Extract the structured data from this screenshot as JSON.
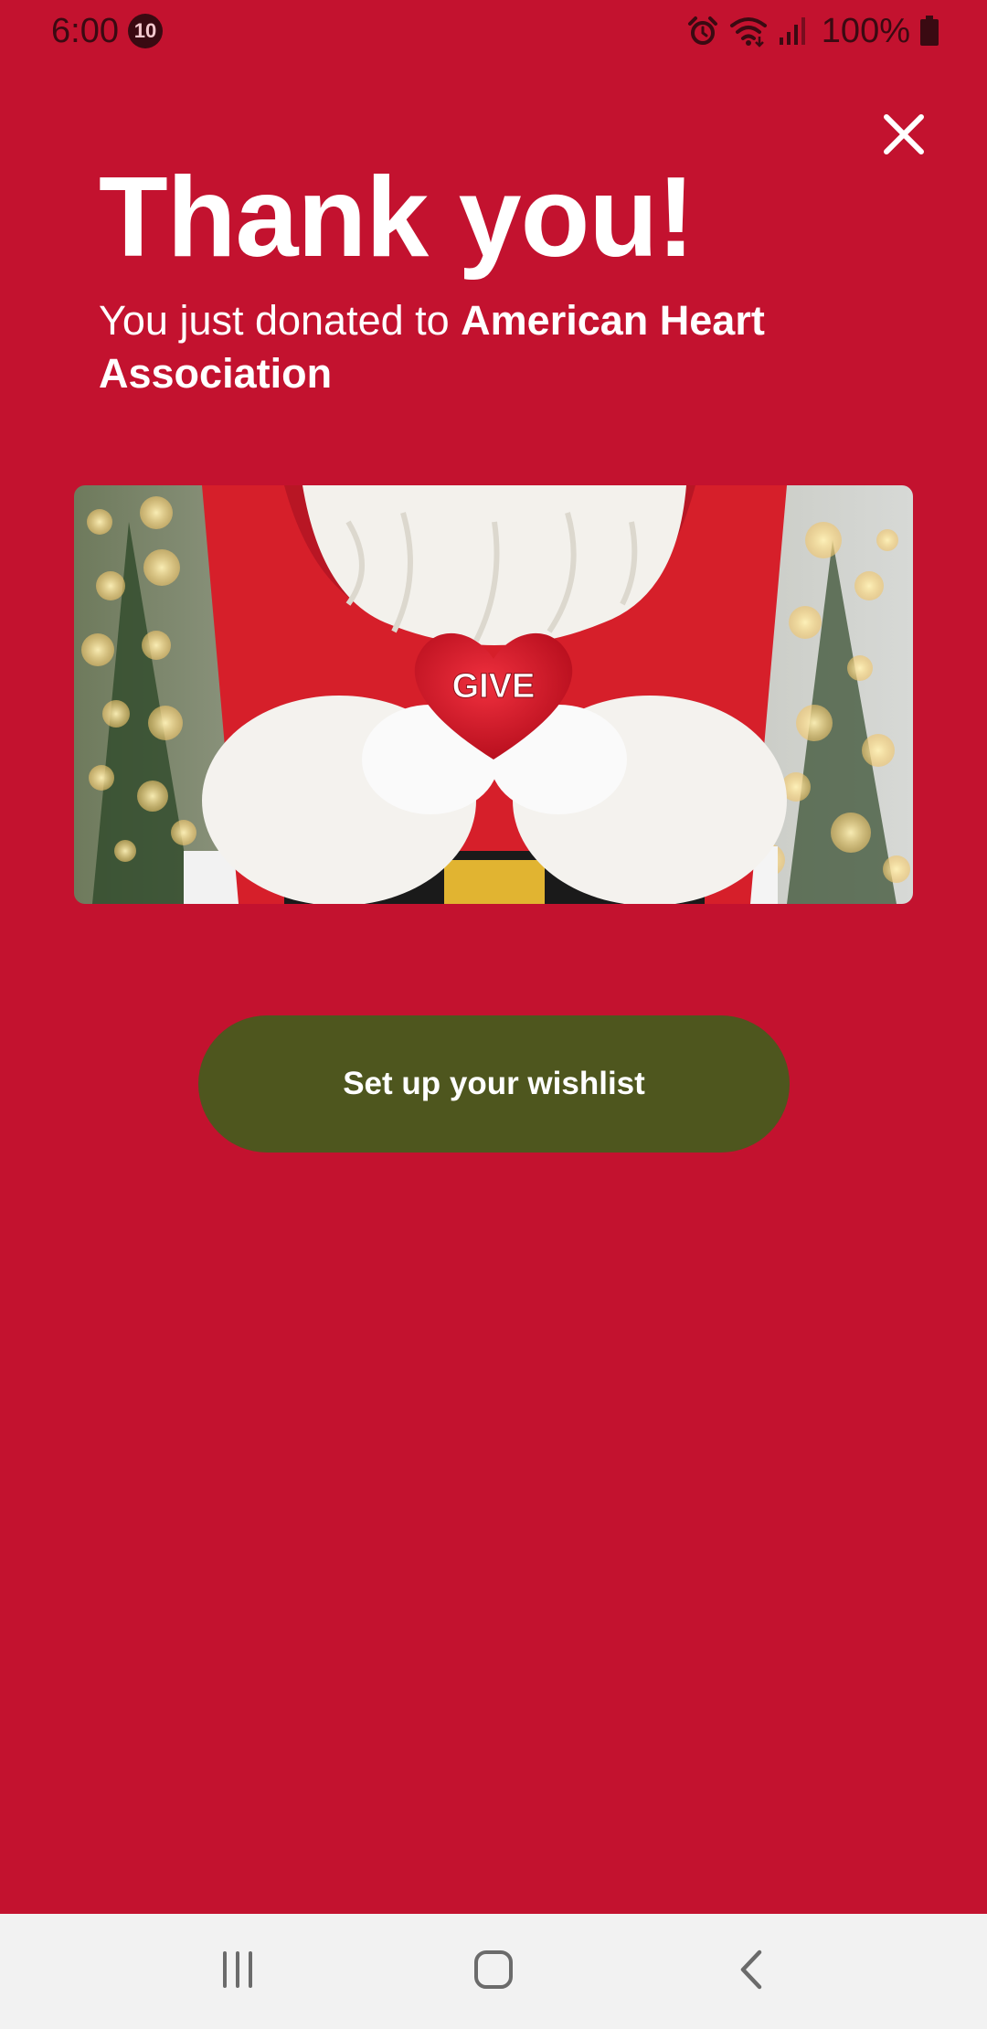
{
  "status_bar": {
    "time": "6:00",
    "notification_count": "10",
    "battery": "100%",
    "icons": [
      "alarm-icon",
      "wifi-icon",
      "signal-icon",
      "battery-icon"
    ]
  },
  "close_icon": "close-icon",
  "title": "Thank you!",
  "subtitle": {
    "prefix": "You just donated to ",
    "charity": "American Heart Association"
  },
  "hero_image": {
    "alt": "Santa holding a red heart",
    "heart_text": "GIVE"
  },
  "cta_label": "Set up your wishlist",
  "nav_bar": {
    "icons": [
      "recent-apps-icon",
      "home-icon",
      "back-icon"
    ]
  },
  "colors": {
    "background": "#C3122F",
    "button": "#4E561E",
    "nav_bar": "#F2F2F2"
  }
}
